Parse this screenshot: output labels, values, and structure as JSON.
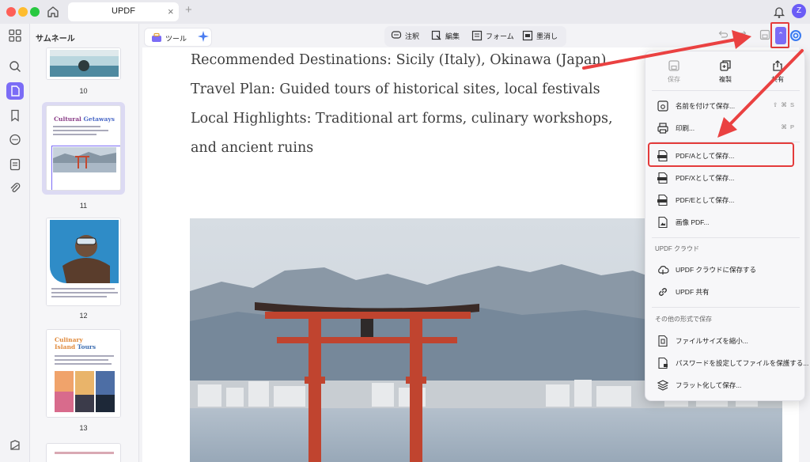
{
  "window": {
    "tab_title": "UPDF",
    "tab_close": "×",
    "tab_add": "+",
    "avatar_letter": "Z"
  },
  "sidebar": {
    "title": "サムネール",
    "rail_icons": [
      "thumbnails-icon",
      "search-icon",
      "page-icon",
      "bookmark-icon",
      "comment-icon",
      "attachment-list-icon",
      "paperclip-icon",
      "layers-icon"
    ]
  },
  "thumbnails": [
    {
      "page": "10"
    },
    {
      "page": "11",
      "heading_part1": "Cultural ",
      "heading_part2": "Getaways"
    },
    {
      "page": "12"
    },
    {
      "page": "13",
      "heading_part1": "Culinary",
      "heading_part2": "Island ",
      "heading_part3": "Tours"
    }
  ],
  "toolbar": {
    "tool_label": "ツール",
    "annotate_label": "注釈",
    "edit_label": "編集",
    "form_label": "フォーム",
    "redact_label": "墨消し"
  },
  "document": {
    "lines": [
      "Recommended Destinations: Sicily (Italy), Okinawa (Japan)",
      "Travel Plan: Guided tours of historical sites, local festivals",
      "Local Highlights: Traditional art forms, culinary workshops,",
      "and ancient ruins"
    ]
  },
  "export_menu": {
    "quick_actions": [
      {
        "label": "保存",
        "icon": "save-icon",
        "disabled": true
      },
      {
        "label": "複製",
        "icon": "duplicate-icon",
        "disabled": false
      },
      {
        "label": "共有",
        "icon": "share-icon",
        "disabled": false
      }
    ],
    "items": [
      {
        "label": "名前を付けて保存...",
        "icon": "save-as-icon",
        "shortcut": "⇧ ⌘ S"
      },
      {
        "label": "印刷...",
        "icon": "print-icon",
        "shortcut": "⌘ P"
      },
      {
        "label": "PDF/Aとして保存...",
        "icon": "pdfa-icon",
        "shortcut": ""
      },
      {
        "label": "PDF/Xとして保存...",
        "icon": "pdfx-icon",
        "shortcut": ""
      },
      {
        "label": "PDF/Eとして保存...",
        "icon": "pdfe-icon",
        "shortcut": ""
      },
      {
        "label": "画像 PDF...",
        "icon": "image-pdf-icon",
        "shortcut": ""
      }
    ],
    "cloud_section": "UPDF クラウド",
    "cloud_items": [
      {
        "label": "UPDF クラウドに保存する",
        "icon": "cloud-upload-icon"
      },
      {
        "label": "UPDF 共有",
        "icon": "link-icon"
      }
    ],
    "other_section": "その他の形式で保存",
    "other_items": [
      {
        "label": "ファイルサイズを縮小...",
        "icon": "compress-icon"
      },
      {
        "label": "パスワードを設定してファイルを保護する...",
        "icon": "protect-icon"
      },
      {
        "label": "フラット化して保存...",
        "icon": "flatten-icon"
      }
    ]
  },
  "colors": {
    "accent": "#7b6cf6",
    "highlight": "#e43b3b",
    "arrow": "#ea4141"
  }
}
